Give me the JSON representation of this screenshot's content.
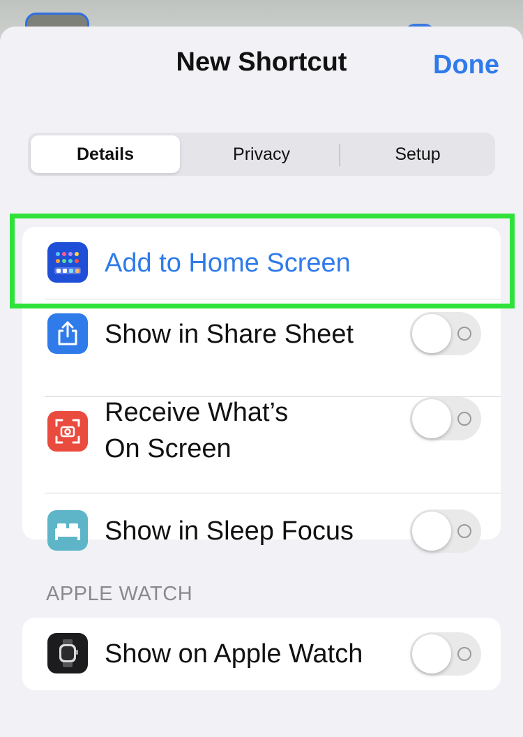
{
  "header": {
    "title": "New Shortcut",
    "done_label": "Done"
  },
  "tabs": [
    {
      "label": "Details",
      "active": true
    },
    {
      "label": "Privacy",
      "active": false
    },
    {
      "label": "Setup",
      "active": false
    }
  ],
  "rows": [
    {
      "label": "Add to Home Screen",
      "icon": "home-screen-grid-icon",
      "color": "#1f4fd6"
    },
    {
      "label": "Show in Share Sheet",
      "icon": "share-icon",
      "color": "#2f7bea",
      "toggle_on": false
    },
    {
      "label_line1": "Receive What’s",
      "label_line2": "On Screen",
      "icon": "screen-capture-icon",
      "color": "#ea4b3f",
      "toggle_on": false
    },
    {
      "label": "Show in Sleep Focus",
      "icon": "bed-icon",
      "color": "#5eb5c8",
      "toggle_on": false
    }
  ],
  "apple_watch": {
    "header": "APPLE WATCH",
    "row": {
      "label": "Show on Apple Watch",
      "icon": "apple-watch-icon",
      "color": "#1c1c1e",
      "toggle_on": false
    }
  },
  "colors": {
    "accent": "#2f7bea",
    "highlight": "#2ee23a",
    "background": "#f1f1f6"
  }
}
